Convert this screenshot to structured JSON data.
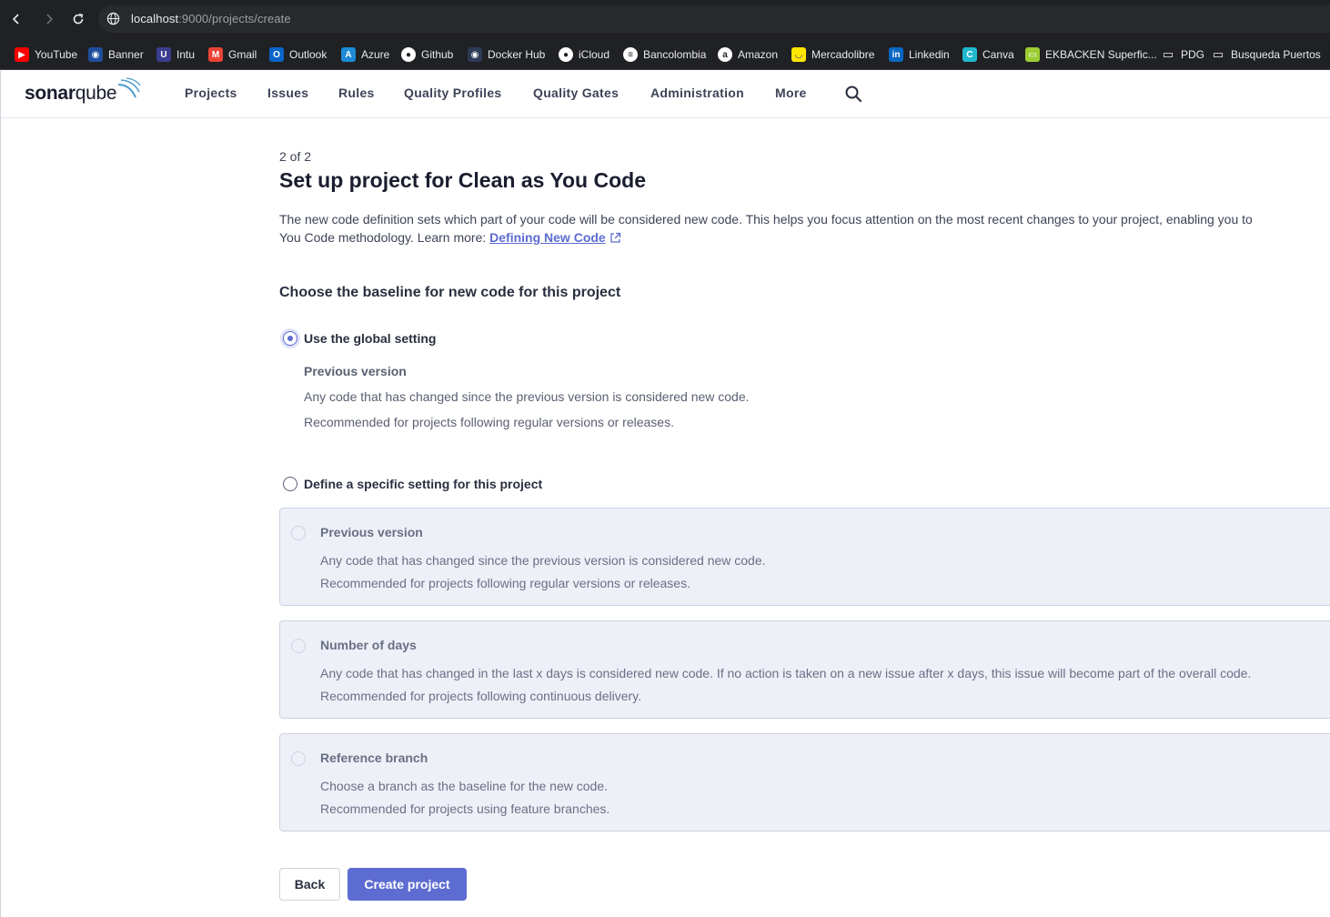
{
  "browser": {
    "url_host": "localhost",
    "url_path": ":9000/projects/create",
    "bookmarks": [
      {
        "label": "YouTube",
        "icon": "youtube-icon",
        "color": "#ff0000"
      },
      {
        "label": "Banner",
        "icon": "globe-icon",
        "color": "#1f4e9c"
      },
      {
        "label": "Intu",
        "icon": "intu-icon",
        "color": "#3b3d8f"
      },
      {
        "label": "Gmail",
        "icon": "gmail-icon",
        "color": "#ea4335"
      },
      {
        "label": "Outlook",
        "icon": "outlook-icon",
        "color": "#0a64c9"
      },
      {
        "label": "Azure",
        "icon": "azure-icon",
        "color": "#1c8ad8"
      },
      {
        "label": "Github",
        "icon": "github-icon",
        "color": "#ffffff"
      },
      {
        "label": "Docker Hub",
        "icon": "docker-icon",
        "color": "#2b3a55"
      },
      {
        "label": "iCloud",
        "icon": "apple-icon",
        "color": "#ffffff"
      },
      {
        "label": "Bancolombia",
        "icon": "bancolombia-icon",
        "color": "#ffffff"
      },
      {
        "label": "Amazon",
        "icon": "amazon-icon",
        "color": "#ffffff"
      },
      {
        "label": "Mercadolibre",
        "icon": "mercadolibre-icon",
        "color": "#ffe600"
      },
      {
        "label": "Linkedin",
        "icon": "linkedin-icon",
        "color": "#0a66c2"
      },
      {
        "label": "Canva",
        "icon": "canva-icon",
        "color": "#20b8cd"
      },
      {
        "label": "EKBACKEN Superfic...",
        "icon": "ekbacken-icon",
        "color": "#9acd32"
      },
      {
        "label": "PDG",
        "icon": "folder-icon",
        "color": "#e8eaed"
      },
      {
        "label": "Busqueda Puertos",
        "icon": "folder-icon",
        "color": "#e8eaed"
      }
    ]
  },
  "header": {
    "logo_bold": "sonar",
    "logo_light": "qube",
    "menu": [
      "Projects",
      "Issues",
      "Rules",
      "Quality Profiles",
      "Quality Gates",
      "Administration",
      "More"
    ]
  },
  "page": {
    "step": "2 of 2",
    "title": "Set up project for Clean as You Code",
    "desc_line1": "The new code definition sets which part of your code will be considered new code. This helps you focus attention on the most recent changes to your project, enabling you to",
    "desc_line2": "You Code methodology. Learn more: ",
    "desc_link": "Defining New Code",
    "section_title": "Choose the baseline for new code for this project",
    "global_option": {
      "label": "Use the global setting",
      "selected": true,
      "sub_title": "Previous version",
      "sub_text1": "Any code that has changed since the previous version is considered new code.",
      "sub_text2": "Recommended for projects following regular versions or releases."
    },
    "specific_option": {
      "label": "Define a specific setting for this project",
      "selected": false
    },
    "cards": [
      {
        "title": "Previous version",
        "text1": "Any code that has changed since the previous version is considered new code.",
        "text2": "Recommended for projects following regular versions or releases."
      },
      {
        "title": "Number of days",
        "text1": "Any code that has changed in the last x days is considered new code. If no action is taken on a new issue after x days, this issue will become part of the overall code.",
        "text2": "Recommended for projects following continuous delivery."
      },
      {
        "title": "Reference branch",
        "text1": "Choose a branch as the baseline for the new code.",
        "text2": "Recommended for projects using feature branches."
      }
    ],
    "back_label": "Back",
    "create_label": "Create project"
  },
  "colors": {
    "accent": "#5d6cd0",
    "card_bg": "#eef0f8"
  }
}
